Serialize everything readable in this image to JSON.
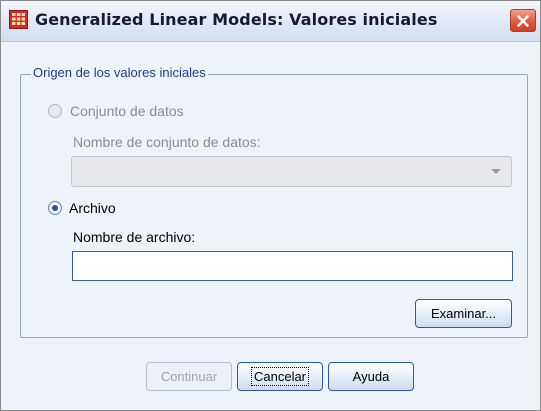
{
  "window": {
    "title": "Generalized Linear Models: Valores iniciales",
    "icons": {
      "app": "spss-grid-icon",
      "close": "close-icon"
    }
  },
  "group": {
    "legend": "Origen de los valores iniciales",
    "dataset_option": {
      "label": "Conjunto de datos",
      "selected": false,
      "enabled": false
    },
    "dataset_name_label": "Nombre de conjunto de datos:",
    "dataset_combo": {
      "value": "",
      "enabled": false
    },
    "file_option": {
      "label": "Archivo",
      "selected": true,
      "enabled": true
    },
    "file_name_label": "Nombre de archivo:",
    "file_name_value": "",
    "browse_button": "Examinar..."
  },
  "buttons": {
    "continue": "Continuar",
    "cancel": "Cancelar",
    "help": "Ayuda"
  },
  "colors": {
    "legend_text": "#1b3c8c",
    "button_border": "#2d5aa8",
    "dialog_background": "#eef3fa",
    "close_button": "#dd5a3e"
  }
}
